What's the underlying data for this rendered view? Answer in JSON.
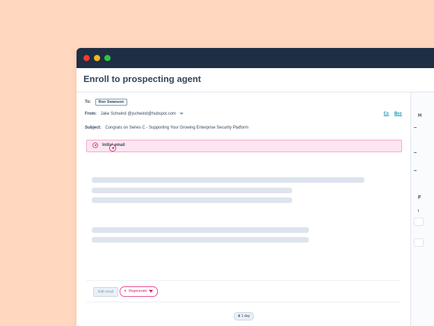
{
  "app": {
    "title": "Enroll to prospecting agent"
  },
  "email": {
    "to_label": "To:",
    "to_value": "Ron Swanson",
    "from_label": "From:",
    "from_value": "Jake Schwind @jschwind@hubspot.com",
    "cc_label": "Cc",
    "bcc_label": "Bcc",
    "subject_label": "Subject:",
    "subject_value": "Congrats on Series C - Supporting Your Growing Enterprise Security Platform"
  },
  "step": {
    "label": "Initial email"
  },
  "actions": {
    "edit_label": "Edit email",
    "regenerate_label": "Regenerate"
  },
  "delay": {
    "label": "1 day"
  },
  "side_panel": {
    "letter_top": "H",
    "letter_bottom": "F",
    "letter_small": "I"
  },
  "colors": {
    "accent": "#e8478b",
    "titlebar": "#1f2f43",
    "background": "#ffd8bf"
  }
}
